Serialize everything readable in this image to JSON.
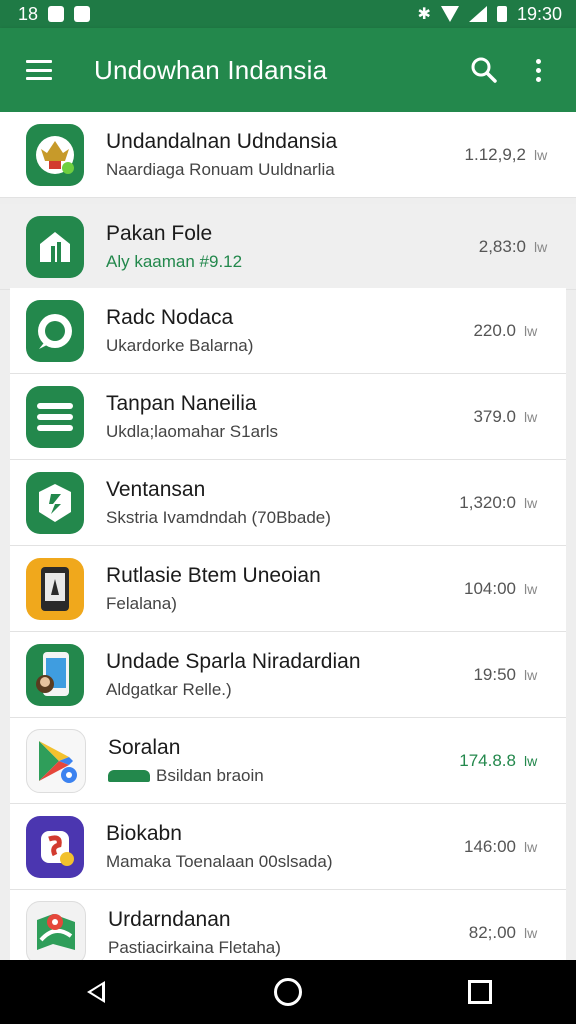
{
  "status_bar": {
    "left_text": "18",
    "time": "19:30"
  },
  "app_bar": {
    "title": "Undowhan Indansia",
    "menu_icon": "menu-icon",
    "search_icon": "search-icon",
    "more_icon": "more-vert-icon"
  },
  "colors": {
    "primary": "#23884c",
    "primary_dark": "#1f7a45",
    "accent_green": "#23884c",
    "background": "#eeeeee"
  },
  "items": [
    {
      "title": "Undandalnan Udndansia",
      "subtitle": "Naardiaga Ronuam Uuldnarlia",
      "value": "1.12,9,2",
      "trail": "lw",
      "icon": "emblem-icon",
      "icon_color": "#23884c"
    },
    {
      "title": "Pakan Fole",
      "subtitle": "Aly kaaman #9.12",
      "value": "2,83:0",
      "trail": "lw",
      "icon": "house-icon",
      "icon_color": "#23884c"
    },
    {
      "title": "Radc Nodaca",
      "subtitle": "Ukardorke Balarna)",
      "value": "220.0",
      "trail": "lw",
      "icon": "chat-icon",
      "icon_color": "#23884c"
    },
    {
      "title": "Tanpan Naneilia",
      "subtitle": "Ukdla;laomahar S1arls",
      "value": "379.0",
      "trail": "lw",
      "icon": "stripes-icon",
      "icon_color": "#23884c"
    },
    {
      "title": "Ventansan",
      "subtitle": "Skstria Ivamdndah (70Bbade)",
      "value": "1,320:0",
      "trail": "lw",
      "icon": "shield-icon",
      "icon_color": "#23884c"
    },
    {
      "title": "Rutlasie Btem Uneoian",
      "subtitle": "Felalana)",
      "value": "104:00",
      "trail": "lw",
      "icon": "phone-icon",
      "icon_color": "#f0a81c"
    },
    {
      "title": "Undade Sparla Niradardian",
      "subtitle": "Aldgatkar Relle.)",
      "value": "19:50",
      "trail": "lw",
      "icon": "phone-user-icon",
      "icon_color": "#23884c"
    },
    {
      "title": "Soralan",
      "subtitle": "Bsildan braoin",
      "value": "174.8.8",
      "trail": "lw",
      "icon": "play-store-icon",
      "icon_color": "#f7f7f7"
    },
    {
      "title": "Biokabn",
      "subtitle": "Mamaka Toenalaan 00slsada)",
      "value": "146:00",
      "trail": "lw",
      "icon": "s-badge-icon",
      "icon_color": "#4b36b0"
    },
    {
      "title": "Urdarndanan",
      "subtitle": "Pastiacirkaina Fletaha)",
      "value": "82;.00",
      "trail": "lw",
      "icon": "map-icon",
      "icon_color": "#f2f2f2"
    }
  ]
}
